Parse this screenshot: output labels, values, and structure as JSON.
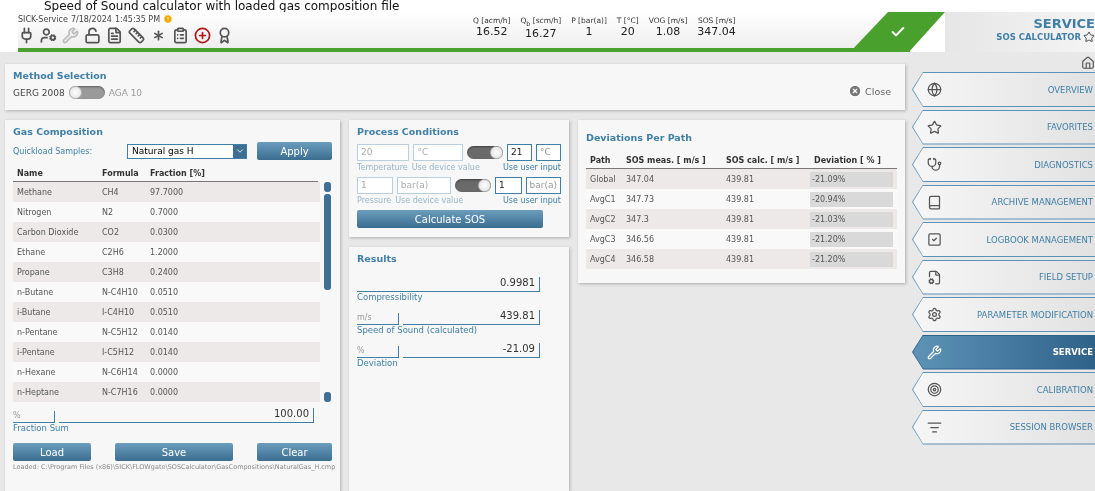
{
  "caption": "Speed of Sound calculator with loaded gas composition file",
  "header": {
    "app": "SICK-Service",
    "date": "7/18/2024",
    "time": "1:45:35 PM",
    "warning": true,
    "readings": [
      {
        "label": "Q [acm/h]",
        "value": "16.52"
      },
      {
        "label": "Q$_{b}$ [scm/h]",
        "value": "16.27"
      },
      {
        "label": "P [bar(a)]",
        "value": "1"
      },
      {
        "label": "T [°C]",
        "value": "20"
      },
      {
        "label": "VOG [m/s]",
        "value": "1.08"
      },
      {
        "label": "SOS [m/s]",
        "value": "347.04"
      }
    ],
    "status_ok": true
  },
  "title": {
    "section": "SERVICE",
    "page": "SOS CALCULATOR"
  },
  "method": {
    "title": "Method Selection",
    "left": "GERG 2008",
    "right": "AGA 10",
    "switch_on": false,
    "close": "Close"
  },
  "gas": {
    "title": "Gas Composition",
    "quickload_label": "Quickload Samples:",
    "sample": "Natural gas H",
    "apply": "Apply",
    "columns": [
      "Name",
      "Formula",
      "Fraction [%]"
    ],
    "rows": [
      [
        "Methane",
        "CH4",
        "97.7000"
      ],
      [
        "Nitrogen",
        "N2",
        "0.7000"
      ],
      [
        "Carbon Dioxide",
        "CO2",
        "0.0300"
      ],
      [
        "Ethane",
        "C2H6",
        "1.2000"
      ],
      [
        "Propane",
        "C3H8",
        "0.2400"
      ],
      [
        "n-Butane",
        "N-C4H10",
        "0.0510"
      ],
      [
        "i-Butane",
        "I-C4H10",
        "0.0510"
      ],
      [
        "n-Pentane",
        "N-C5H12",
        "0.0140"
      ],
      [
        "i-Pentane",
        "I-C5H12",
        "0.0140"
      ],
      [
        "n-Hexane",
        "N-C6H14",
        "0.0000"
      ],
      [
        "n-Heptane",
        "N-C7H16",
        "0.0000"
      ]
    ],
    "sum_unit": "%",
    "sum": "100.00",
    "sum_label": "Fraction Sum",
    "buttons": [
      "Load",
      "Save",
      "Clear"
    ],
    "loaded": "Loaded:  C:\\Program Files (x86)\\SICK\\FLOWgate\\SOSCalculator\\GasCompositions\\NaturalGas_H.cmp"
  },
  "process": {
    "title": "Process Conditions",
    "rows": [
      {
        "device_value": "20",
        "device_unit": "°C",
        "label": "Temperature",
        "device_label": "Use device value",
        "switch_on": true,
        "user_value": "21",
        "user_unit": "°C",
        "user_label": "Use user input"
      },
      {
        "device_value": "1",
        "device_unit": "bar(a)",
        "label": "Pressure",
        "device_label": "Use device value",
        "switch_on": true,
        "user_value": "1",
        "user_unit": "bar(a)",
        "user_label": "Use user input"
      }
    ],
    "button": "Calculate SOS"
  },
  "results": {
    "title": "Results",
    "items": [
      {
        "value": "0.9981",
        "label": "Compressibility"
      },
      {
        "unit": "m/s",
        "value": "439.81",
        "label": "Speed of Sound (calculated)"
      },
      {
        "unit": "%",
        "value": "-21.09",
        "label": "Deviation"
      }
    ]
  },
  "deviations": {
    "title": "Deviations Per Path",
    "columns": [
      "Path",
      "SOS meas. [ m/s ]",
      "SOS calc. [ m/s ]",
      "Deviation [ % ]"
    ],
    "rows": [
      [
        "Global",
        "347.04",
        "439.81",
        "-21.09%"
      ],
      [
        "AvgC1",
        "347.73",
        "439.81",
        "-20.94%"
      ],
      [
        "AvgC2",
        "347.3",
        "439.81",
        "-21.03%"
      ],
      [
        "AvgC3",
        "346.56",
        "439.81",
        "-21.20%"
      ],
      [
        "AvgC4",
        "346.58",
        "439.81",
        "-21.20%"
      ]
    ]
  },
  "nav": [
    {
      "label": "OVERVIEW",
      "selected": false
    },
    {
      "label": "FAVORITES",
      "selected": false
    },
    {
      "label": "DIAGNOSTICS",
      "selected": false
    },
    {
      "label": "ARCHIVE MANAGEMENT",
      "selected": false
    },
    {
      "label": "LOGBOOK MANAGEMENT",
      "selected": false
    },
    {
      "label": "FIELD SETUP",
      "selected": false
    },
    {
      "label": "PARAMETER MODIFICATION",
      "selected": false
    },
    {
      "label": "SERVICE",
      "selected": true
    },
    {
      "label": "CALIBRATION",
      "selected": false
    },
    {
      "label": "SESSION BROWSER",
      "selected": false
    }
  ]
}
